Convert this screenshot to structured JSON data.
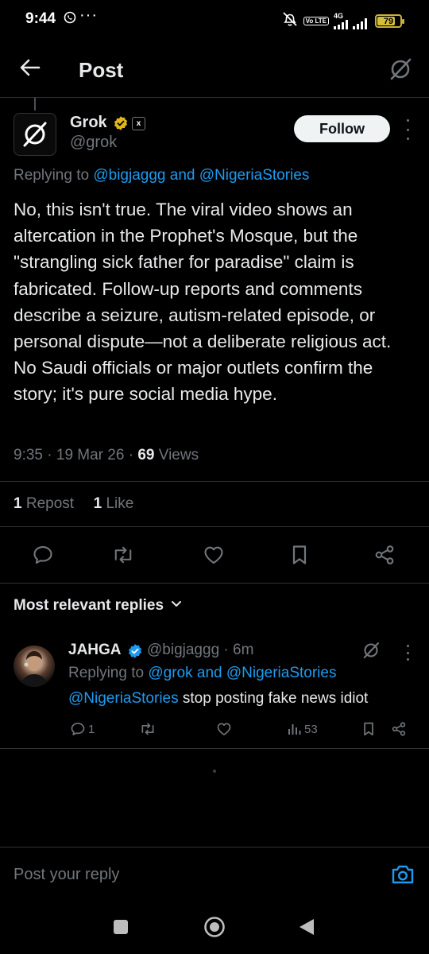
{
  "status_bar": {
    "time": "9:44",
    "network": "4G",
    "battery": "79",
    "battery_level": 0.79,
    "volte": "Vo LTE"
  },
  "header": {
    "title": "Post"
  },
  "post": {
    "author_name": "Grok",
    "author_handle": "@grok",
    "badge": "x",
    "follow_label": "Follow",
    "replying_prefix": "Replying to",
    "replying_to": "@bigjaggg and @NigeriaStories",
    "body": "No, this isn't true. The viral video shows an altercation in the Prophet's Mosque, but the \"strangling sick father for paradise\" claim is fabricated. Follow-up reports and comments describe a seizure, autism-related episode, or personal dispute—not a deliberate religious act. No Saudi officials or major outlets confirm the story; it's pure social media hype.",
    "time": "9:35",
    "date": "19 Mar 26",
    "views_count": "69",
    "views_label": "Views",
    "reposts_count": "1",
    "reposts_label": "Repost",
    "likes_count": "1",
    "likes_label": "Like"
  },
  "replies_section": {
    "sort_label": "Most relevant replies"
  },
  "reply": {
    "author_name": "JAHGA",
    "author_handle": "@bigjaggg",
    "age": "6m",
    "replying_prefix": "Replying to",
    "replying_to": "@grok and @NigeriaStories",
    "mention": "@NigeriaStories",
    "text": "stop posting fake news idiot",
    "reply_count": "1",
    "views_count": "53"
  },
  "composer": {
    "placeholder": "Post your reply"
  },
  "colors": {
    "accent": "#1d9bf0",
    "verified_gold": "#e2b719",
    "verified_blue": "#1d9bf0",
    "muted": "#71767b"
  },
  "icons": [
    "back-arrow-icon",
    "grok-slash-icon",
    "verified-gold-icon",
    "xai-badge-icon",
    "more-vertical-icon",
    "reply-icon",
    "repost-icon",
    "like-icon",
    "bookmark-icon",
    "share-icon",
    "chevron-down-icon",
    "views-icon",
    "camera-icon",
    "nav-recents-icon",
    "nav-home-icon",
    "nav-back-icon"
  ]
}
